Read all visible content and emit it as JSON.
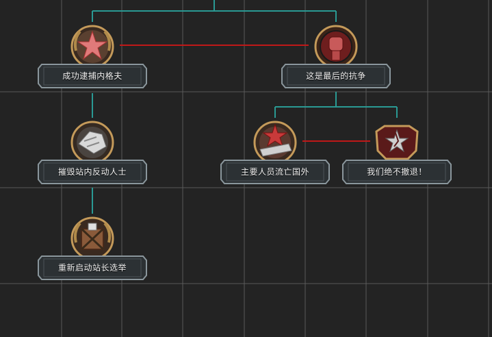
{
  "focuses": [
    {
      "id": "capture",
      "name": "成功逮捕内格夫",
      "icon": "red-star-laurel-icon"
    },
    {
      "id": "last_struggle",
      "name": "这是最后的抗争",
      "icon": "raised-fist-icon"
    },
    {
      "id": "destroy_reactionaries",
      "name": "摧毁站内反动人士",
      "icon": "smashed-hand-icon"
    },
    {
      "id": "leaders_exile",
      "name": "主要人员流亡国外",
      "icon": "star-train-icon"
    },
    {
      "id": "no_retreat",
      "name": "我们绝不撤退！",
      "icon": "broken-star-shield-icon"
    },
    {
      "id": "restart_elections",
      "name": "重新启动站长选举",
      "icon": "chained-crate-icon"
    }
  ],
  "colors": {
    "background": "#232323",
    "grid": "#5a5a5a",
    "prerequisite_line": "#2a9a94",
    "exclusive_line": "#c01818",
    "plate_fill": "#2c3134",
    "plate_border": "#8a969c"
  }
}
